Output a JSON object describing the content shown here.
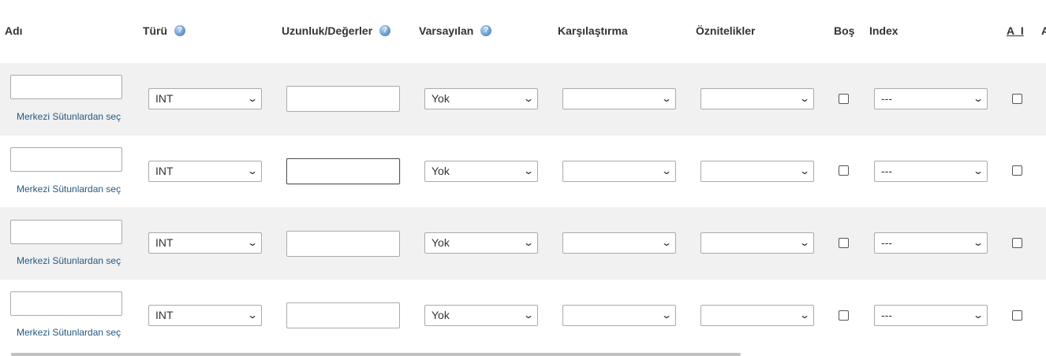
{
  "header": {
    "name": "Adı",
    "type": "Türü",
    "length": "Uzunluk/Değerler",
    "default": "Varsayılan",
    "collation": "Karşılaştırma",
    "attributes": "Öznitelikler",
    "null": "Boş",
    "index": "Index",
    "ai": "A_I",
    "cut": "A"
  },
  "rows": [
    {
      "central_link": "Merkezi Sütunlardan seç",
      "type": "INT",
      "default": "Yok",
      "collation": "",
      "attributes": "",
      "index": "---"
    },
    {
      "central_link": "Merkezi Sütunlardan seç",
      "type": "INT",
      "default": "Yok",
      "collation": "",
      "attributes": "",
      "index": "---"
    },
    {
      "central_link": "Merkezi Sütunlardan seç",
      "type": "INT",
      "default": "Yok",
      "collation": "",
      "attributes": "",
      "index": "---"
    },
    {
      "central_link": "Merkezi Sütunlardan seç",
      "type": "INT",
      "default": "Yok",
      "collation": "",
      "attributes": "",
      "index": "---"
    }
  ],
  "icons": {
    "help": "help-icon",
    "dropdown": "chevron-down-icon"
  },
  "colors": {
    "link": "#235a81",
    "row_alt": "#f1f1f1"
  }
}
